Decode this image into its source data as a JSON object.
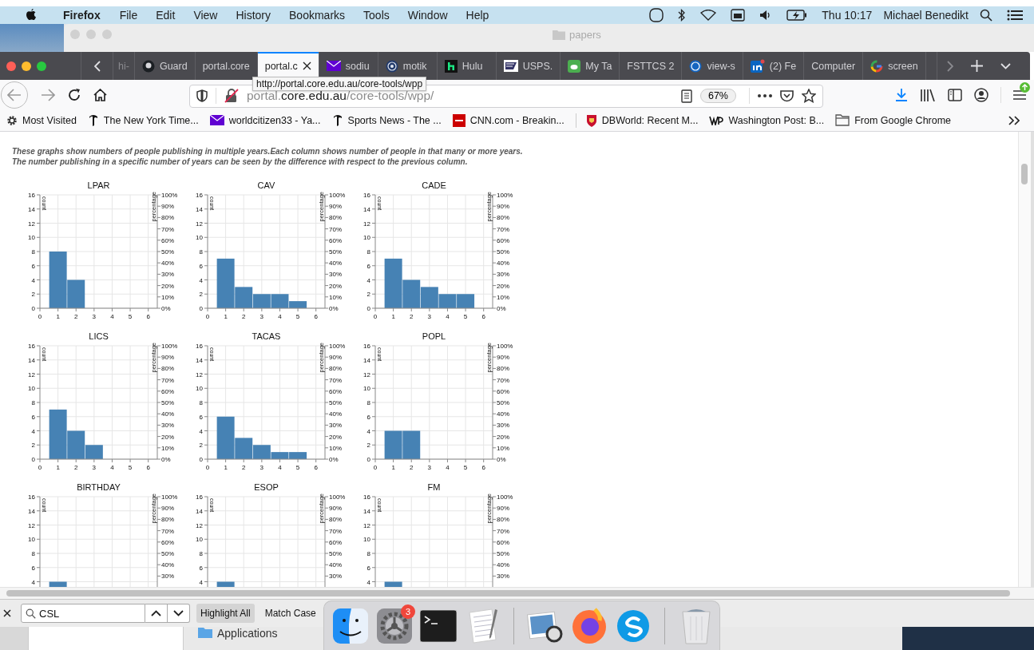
{
  "menubar": {
    "app": "Firefox",
    "menus": [
      "File",
      "Edit",
      "View",
      "History",
      "Bookmarks",
      "Tools",
      "Window",
      "Help"
    ],
    "clock": "Thu 10:17",
    "user": "Michael Benedikt"
  },
  "background_window": {
    "title": "papers"
  },
  "tabs": [
    {
      "label": "hi-",
      "selected": false
    },
    {
      "label": "Guard",
      "selected": false
    },
    {
      "label": "portal.core",
      "selected": false
    },
    {
      "label": "portal.c",
      "selected": true
    },
    {
      "label": "sodiu",
      "selected": false
    },
    {
      "label": "motik",
      "selected": false
    },
    {
      "label": "Hulu",
      "selected": false
    },
    {
      "label": "USPS.",
      "selected": false
    },
    {
      "label": "My Ta",
      "selected": false
    },
    {
      "label": "FSTTCS 2",
      "selected": false
    },
    {
      "label": "view-s",
      "selected": false
    },
    {
      "label": "(2) Fe",
      "selected": false
    },
    {
      "label": "Computer",
      "selected": false
    },
    {
      "label": "screen",
      "selected": false
    }
  ],
  "navbar": {
    "url": "portal.**core.edu.au**/core-tools/wpp/",
    "tooltip": "http://portal.core.edu.au/core-tools/wpp",
    "zoom": "67%"
  },
  "bookmarks": [
    {
      "label": "Most Visited"
    },
    {
      "label": "The New York Time..."
    },
    {
      "label": "worldcitizen33 - Ya..."
    },
    {
      "label": "Sports News - The ..."
    },
    {
      "label": "CNN.com - Breakin..."
    },
    {
      "label": "DBWorld: Recent M..."
    },
    {
      "label": "Washington Post: B..."
    },
    {
      "label": "From Google Chrome"
    }
  ],
  "page": {
    "description": "These graphs show numbers of people publishing in multiple years.Each column shows number of people in that many or more years. The number publishing in a specific number of years can be seen by the difference with respect to the previous column.",
    "charts": [
      {
        "chart_data": {
          "type": "bar",
          "title": "LPAR",
          "ylabel": "count",
          "y2label": "percentage",
          "x": [
            1,
            2
          ],
          "values": [
            8,
            4
          ],
          "grid": true,
          "xlim": [
            0,
            6.5
          ],
          "ylim": [
            0,
            16
          ],
          "y2lim": [
            0,
            1
          ],
          "xticks": [
            0,
            1,
            2,
            3,
            4,
            5,
            6
          ],
          "yticks": [
            0,
            2,
            4,
            6,
            8,
            10,
            12,
            14,
            16
          ],
          "y2ticks": [
            {
              "value": 0,
              "label": "0%"
            },
            {
              "value": 0.1,
              "label": "10%"
            },
            {
              "value": 0.2,
              "label": "20%"
            },
            {
              "value": 0.3,
              "label": "30%"
            },
            {
              "value": 0.4,
              "label": "40%"
            },
            {
              "value": 0.5,
              "label": "50%"
            },
            {
              "value": 0.6,
              "label": "60%"
            },
            {
              "value": 0.7,
              "label": "70%"
            },
            {
              "value": 0.8,
              "label": "80%"
            },
            {
              "value": 0.9,
              "label": "90%"
            },
            {
              "value": 1,
              "label": "100%"
            }
          ]
        }
      },
      {
        "chart_data": {
          "type": "bar",
          "title": "CAV",
          "ylabel": "count",
          "y2label": "percentage",
          "x": [
            1,
            2,
            3,
            4,
            5
          ],
          "values": [
            7,
            3,
            2,
            2,
            1
          ],
          "grid": true,
          "xlim": [
            0,
            6.5
          ],
          "ylim": [
            0,
            16
          ],
          "y2lim": [
            0,
            1
          ],
          "xticks": [
            0,
            1,
            2,
            3,
            4,
            5,
            6
          ],
          "yticks": [
            0,
            2,
            4,
            6,
            8,
            10,
            12,
            14,
            16
          ],
          "y2ticks": [
            {
              "value": 0,
              "label": "0%"
            },
            {
              "value": 0.1,
              "label": "10%"
            },
            {
              "value": 0.2,
              "label": "20%"
            },
            {
              "value": 0.3,
              "label": "30%"
            },
            {
              "value": 0.4,
              "label": "40%"
            },
            {
              "value": 0.5,
              "label": "50%"
            },
            {
              "value": 0.6,
              "label": "60%"
            },
            {
              "value": 0.7,
              "label": "70%"
            },
            {
              "value": 0.8,
              "label": "80%"
            },
            {
              "value": 0.9,
              "label": "90%"
            },
            {
              "value": 1,
              "label": "100%"
            }
          ]
        }
      },
      {
        "chart_data": {
          "type": "bar",
          "title": "CADE",
          "ylabel": "count",
          "y2label": "percentage",
          "x": [
            1,
            2,
            3,
            4,
            5
          ],
          "values": [
            7,
            4,
            3,
            2,
            2
          ],
          "grid": true,
          "xlim": [
            0,
            6.5
          ],
          "ylim": [
            0,
            16
          ],
          "y2lim": [
            0,
            1
          ],
          "xticks": [
            0,
            1,
            2,
            3,
            4,
            5,
            6
          ],
          "yticks": [
            0,
            2,
            4,
            6,
            8,
            10,
            12,
            14,
            16
          ],
          "y2ticks": [
            {
              "value": 0,
              "label": "0%"
            },
            {
              "value": 0.1,
              "label": "10%"
            },
            {
              "value": 0.2,
              "label": "20%"
            },
            {
              "value": 0.3,
              "label": "30%"
            },
            {
              "value": 0.4,
              "label": "40%"
            },
            {
              "value": 0.5,
              "label": "50%"
            },
            {
              "value": 0.6,
              "label": "60%"
            },
            {
              "value": 0.7,
              "label": "70%"
            },
            {
              "value": 0.8,
              "label": "80%"
            },
            {
              "value": 0.9,
              "label": "90%"
            },
            {
              "value": 1,
              "label": "100%"
            }
          ]
        }
      },
      {
        "chart_data": {
          "type": "bar",
          "title": "LICS",
          "ylabel": "count",
          "y2label": "percentage",
          "x": [
            1,
            2,
            3
          ],
          "values": [
            7,
            4,
            2
          ],
          "grid": true,
          "xlim": [
            0,
            6.5
          ],
          "ylim": [
            0,
            16
          ],
          "y2lim": [
            0,
            1
          ],
          "xticks": [
            0,
            1,
            2,
            3,
            4,
            5,
            6
          ],
          "yticks": [
            0,
            2,
            4,
            6,
            8,
            10,
            12,
            14,
            16
          ],
          "y2ticks": [
            {
              "value": 0,
              "label": "0%"
            },
            {
              "value": 0.1,
              "label": "10%"
            },
            {
              "value": 0.2,
              "label": "20%"
            },
            {
              "value": 0.3,
              "label": "30%"
            },
            {
              "value": 0.4,
              "label": "40%"
            },
            {
              "value": 0.5,
              "label": "50%"
            },
            {
              "value": 0.6,
              "label": "60%"
            },
            {
              "value": 0.7,
              "label": "70%"
            },
            {
              "value": 0.8,
              "label": "80%"
            },
            {
              "value": 0.9,
              "label": "90%"
            },
            {
              "value": 1,
              "label": "100%"
            }
          ]
        }
      },
      {
        "chart_data": {
          "type": "bar",
          "title": "TACAS",
          "ylabel": "count",
          "y2label": "percentage",
          "x": [
            1,
            2,
            3,
            4,
            5
          ],
          "values": [
            6,
            3,
            2,
            1,
            1
          ],
          "grid": true,
          "xlim": [
            0,
            6.5
          ],
          "ylim": [
            0,
            16
          ],
          "y2lim": [
            0,
            1
          ],
          "xticks": [
            0,
            1,
            2,
            3,
            4,
            5,
            6
          ],
          "yticks": [
            0,
            2,
            4,
            6,
            8,
            10,
            12,
            14,
            16
          ],
          "y2ticks": [
            {
              "value": 0,
              "label": "0%"
            },
            {
              "value": 0.1,
              "label": "10%"
            },
            {
              "value": 0.2,
              "label": "20%"
            },
            {
              "value": 0.3,
              "label": "30%"
            },
            {
              "value": 0.4,
              "label": "40%"
            },
            {
              "value": 0.5,
              "label": "50%"
            },
            {
              "value": 0.6,
              "label": "60%"
            },
            {
              "value": 0.7,
              "label": "70%"
            },
            {
              "value": 0.8,
              "label": "80%"
            },
            {
              "value": 0.9,
              "label": "90%"
            },
            {
              "value": 1,
              "label": "100%"
            }
          ]
        }
      },
      {
        "chart_data": {
          "type": "bar",
          "title": "POPL",
          "ylabel": "count",
          "y2label": "percentage",
          "x": [
            1,
            2
          ],
          "values": [
            4,
            4
          ],
          "grid": true,
          "xlim": [
            0,
            6.5
          ],
          "ylim": [
            0,
            16
          ],
          "y2lim": [
            0,
            1
          ],
          "xticks": [
            0,
            1,
            2,
            3,
            4,
            5,
            6
          ],
          "yticks": [
            0,
            2,
            4,
            6,
            8,
            10,
            12,
            14,
            16
          ],
          "y2ticks": [
            {
              "value": 0,
              "label": "0%"
            },
            {
              "value": 0.1,
              "label": "10%"
            },
            {
              "value": 0.2,
              "label": "20%"
            },
            {
              "value": 0.3,
              "label": "30%"
            },
            {
              "value": 0.4,
              "label": "40%"
            },
            {
              "value": 0.5,
              "label": "50%"
            },
            {
              "value": 0.6,
              "label": "60%"
            },
            {
              "value": 0.7,
              "label": "70%"
            },
            {
              "value": 0.8,
              "label": "80%"
            },
            {
              "value": 0.9,
              "label": "90%"
            },
            {
              "value": 1,
              "label": "100%"
            }
          ]
        }
      },
      {
        "chart_data": {
          "type": "bar",
          "title": "BIRTHDAY",
          "ylabel": "count",
          "y2label": "percentage",
          "values": [
            4
          ],
          "grid": true,
          "ylim": [
            0,
            16
          ],
          "y2lim": [
            0,
            1
          ],
          "yticks": [
            4,
            6,
            8,
            10,
            12,
            14,
            16
          ],
          "y2ticks": [
            {
              "value": 0.3,
              "label": "30%"
            },
            {
              "value": 0.4,
              "label": "40%"
            },
            {
              "value": 0.5,
              "label": "50%"
            },
            {
              "value": 0.6,
              "label": "60%"
            },
            {
              "value": 0.7,
              "label": "70%"
            },
            {
              "value": 0.8,
              "label": "80%"
            },
            {
              "value": 0.9,
              "label": "90%"
            },
            {
              "value": 1,
              "label": "100%"
            }
          ]
        }
      },
      {
        "chart_data": {
          "type": "bar",
          "title": "ESOP",
          "ylabel": "count",
          "y2label": "percentage",
          "values": [
            4
          ],
          "grid": true,
          "ylim": [
            0,
            16
          ],
          "y2lim": [
            0,
            1
          ],
          "yticks": [
            4,
            6,
            8,
            10,
            12,
            14,
            16
          ],
          "y2ticks": [
            {
              "value": 0.3,
              "label": "30%"
            },
            {
              "value": 0.4,
              "label": "40%"
            },
            {
              "value": 0.5,
              "label": "50%"
            },
            {
              "value": 0.6,
              "label": "60%"
            },
            {
              "value": 0.7,
              "label": "70%"
            },
            {
              "value": 0.8,
              "label": "80%"
            },
            {
              "value": 0.9,
              "label": "90%"
            },
            {
              "value": 1,
              "label": "100%"
            }
          ]
        }
      },
      {
        "chart_data": {
          "type": "bar",
          "title": "FM",
          "ylabel": "count",
          "y2label": "percentage",
          "values": [
            4
          ],
          "grid": true,
          "ylim": [
            0,
            16
          ],
          "y2lim": [
            0,
            1
          ],
          "yticks": [
            4,
            6,
            8,
            10,
            12,
            14,
            16
          ],
          "y2ticks": [
            {
              "value": 0.3,
              "label": "30%"
            },
            {
              "value": 0.4,
              "label": "40%"
            },
            {
              "value": 0.5,
              "label": "50%"
            },
            {
              "value": 0.6,
              "label": "60%"
            },
            {
              "value": 0.7,
              "label": "70%"
            },
            {
              "value": 0.8,
              "label": "80%"
            },
            {
              "value": 0.9,
              "label": "90%"
            },
            {
              "value": 1,
              "label": "100%"
            }
          ]
        }
      }
    ]
  },
  "findbar": {
    "query": "CSL",
    "options": [
      {
        "label": "Highlight All",
        "on": true
      },
      {
        "label": "Match Case",
        "on": false
      }
    ]
  },
  "dock": [
    {
      "kind": "finder"
    },
    {
      "kind": "settings",
      "badge": "3"
    },
    {
      "kind": "terminal"
    },
    {
      "kind": "notes"
    },
    {
      "kind": "separator"
    },
    {
      "kind": "preview"
    },
    {
      "kind": "firefox"
    },
    {
      "kind": "skype"
    },
    {
      "kind": "separator"
    },
    {
      "kind": "trash"
    }
  ],
  "desktop": {
    "folder": "Applications"
  }
}
